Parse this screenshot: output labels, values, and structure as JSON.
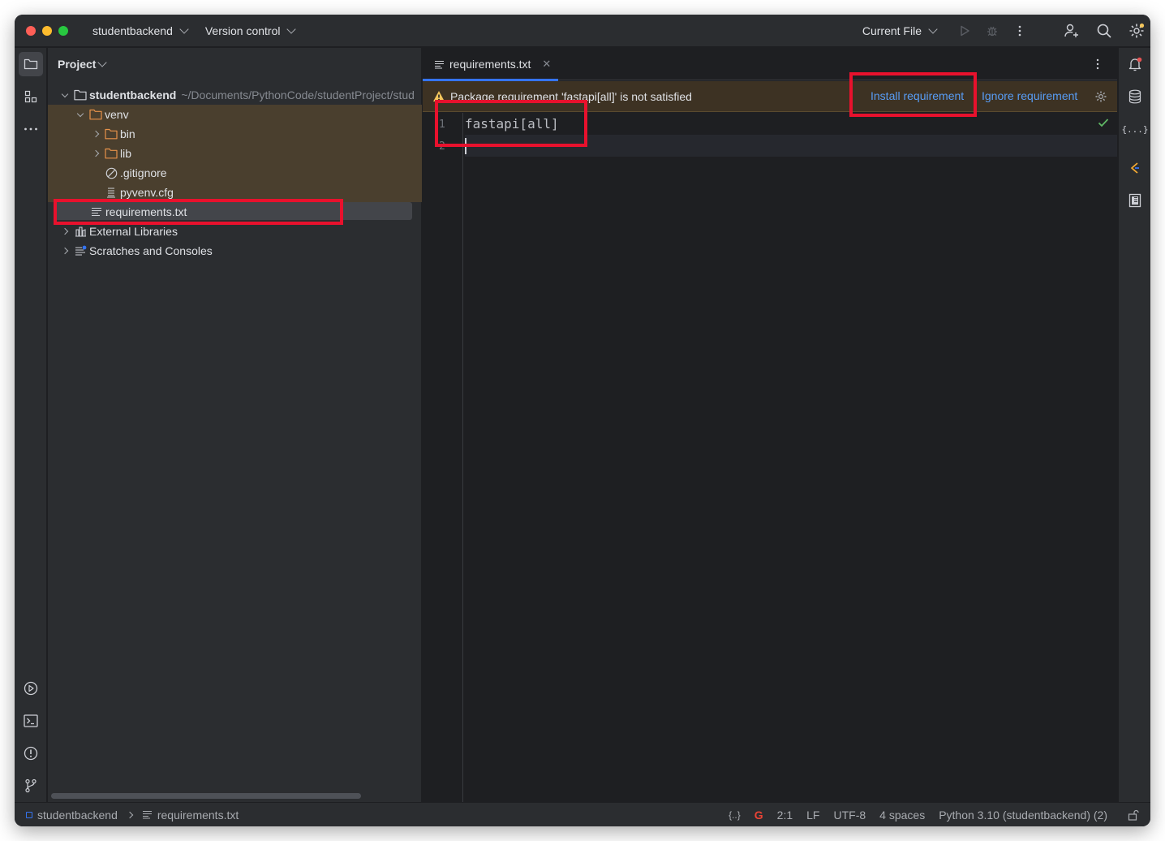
{
  "titlebar": {
    "project_name": "studentbackend",
    "vcs_label": "Version control",
    "run_config": "Current File"
  },
  "project_panel": {
    "title": "Project",
    "tree": [
      {
        "label": "studentbackend",
        "hint": "~/Documents/PythonCode/studentProject/stud",
        "icon": "folder-icon",
        "expanded": true
      },
      {
        "label": "venv",
        "icon": "folder-icon",
        "expanded": true
      },
      {
        "label": "bin",
        "icon": "folder-icon",
        "expanded": false
      },
      {
        "label": "lib",
        "icon": "folder-icon",
        "expanded": false
      },
      {
        "label": ".gitignore",
        "icon": "ignore-file-icon"
      },
      {
        "label": "pyvenv.cfg",
        "icon": "config-file-icon"
      },
      {
        "label": "requirements.txt",
        "icon": "text-file-icon",
        "selected": true
      },
      {
        "label": "External Libraries",
        "icon": "library-icon",
        "expanded": false
      },
      {
        "label": "Scratches and Consoles",
        "icon": "scratches-icon",
        "expanded": false
      }
    ]
  },
  "editor": {
    "tab_label": "requirements.txt",
    "banner_text": "Package requirement 'fastapi[all]' is not satisfied",
    "install_link": "Install requirement",
    "ignore_link": "Ignore requirement",
    "lines": [
      {
        "number": "1",
        "text": "fastapi[all]"
      },
      {
        "number": "2",
        "text": ""
      }
    ]
  },
  "statusbar": {
    "breadcrumb_project": "studentbackend",
    "breadcrumb_file": "requirements.txt",
    "json_indicator": "{..}",
    "position": "2:1",
    "line_separator": "LF",
    "encoding": "UTF-8",
    "indent": "4 spaces",
    "interpreter": "Python 3.10 (studentbackend) (2)"
  },
  "colors": {
    "accent": "#3574f0",
    "link": "#589df6",
    "annotation": "#e8112d",
    "warning": "#f2c55c",
    "excluded_bg": "#4a3f2e"
  }
}
